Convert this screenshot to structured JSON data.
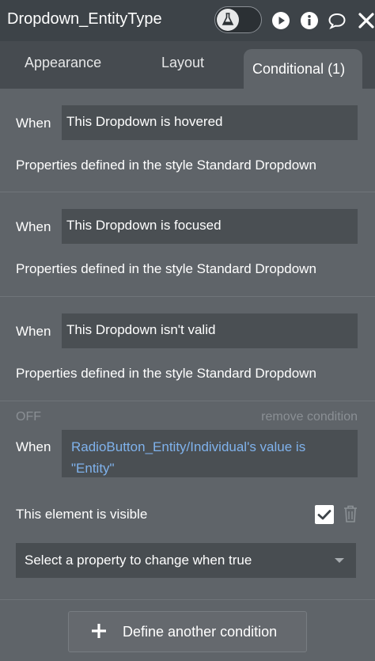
{
  "header": {
    "title": "Dropdown_EntityType",
    "icons": [
      "flask-icon",
      "play-icon",
      "info-icon",
      "comment-icon",
      "close-icon"
    ]
  },
  "tabs": [
    {
      "label": "Appearance",
      "active": false
    },
    {
      "label": "Layout",
      "active": false
    },
    {
      "label": "Conditional (1)",
      "active": true
    }
  ],
  "conditions": [
    {
      "when_label": "When",
      "expression": "This Dropdown is hovered",
      "properties": "Properties defined in the style Standard Dropdown"
    },
    {
      "when_label": "When",
      "expression": "This Dropdown is focused",
      "properties": "Properties defined in the style Standard Dropdown"
    },
    {
      "when_label": "When",
      "expression": "This Dropdown isn't valid",
      "properties": "Properties defined in the style Standard Dropdown"
    }
  ],
  "custom_condition": {
    "status": "OFF",
    "remove_label": "remove condition",
    "when_label": "When",
    "expression_line1": "RadioButton_Entity/Individual's value is",
    "expression_line2": "\"Entity\"",
    "property_label": "This element is visible",
    "property_checked": true,
    "select_placeholder": "Select a property to change when true"
  },
  "footer": {
    "define_label": "Define another condition"
  },
  "colors": {
    "panel_bg": "#5f6469",
    "header_bg": "#3d4348",
    "field_bg": "#4a4f53",
    "expression_link": "#7fb2ec",
    "muted_text": "#8a8f94"
  }
}
